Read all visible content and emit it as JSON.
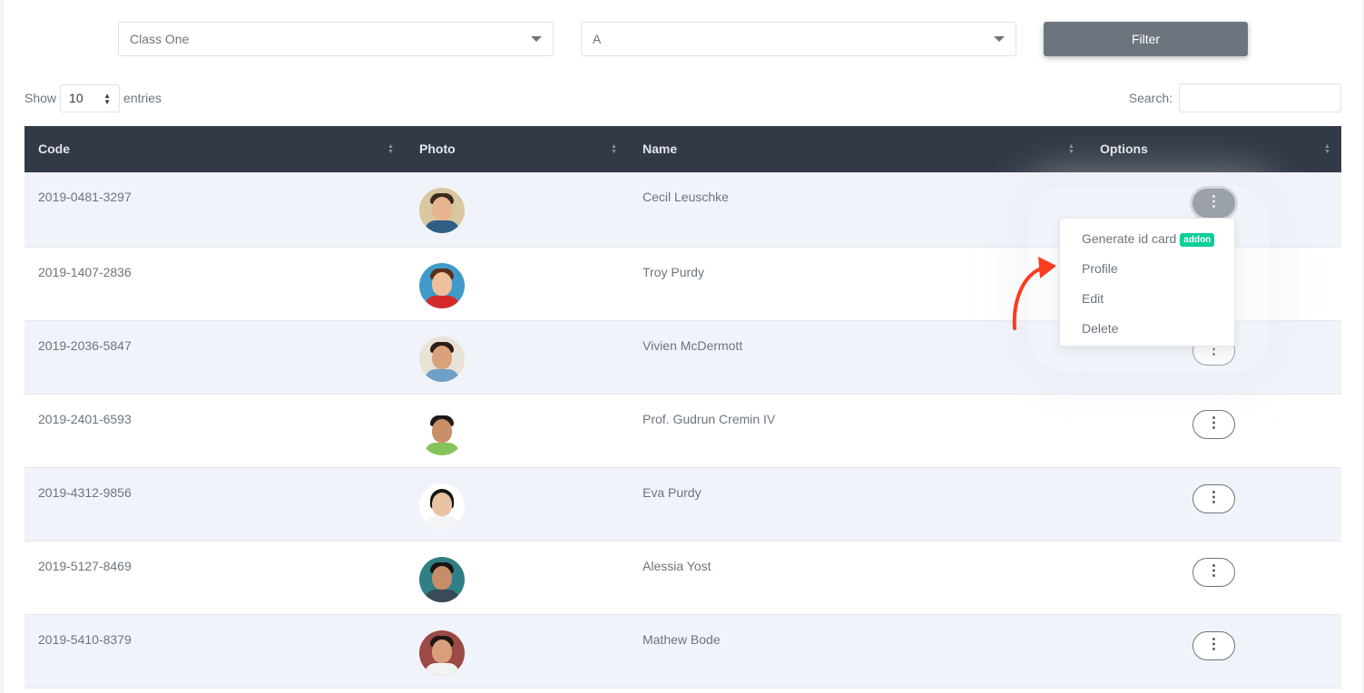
{
  "filters": {
    "class_value": "Class One",
    "section_value": "A",
    "filter_label": "Filter"
  },
  "length": {
    "show_label": "Show",
    "value": "10",
    "entries_label": "entries"
  },
  "search": {
    "label": "Search:",
    "placeholder": ""
  },
  "table": {
    "headers": [
      "Code",
      "Photo",
      "Name",
      "Options"
    ],
    "rows": [
      {
        "code": "2019-0481-3297",
        "name": "Cecil Leuschke"
      },
      {
        "code": "2019-1407-2836",
        "name": "Troy Purdy"
      },
      {
        "code": "2019-2036-5847",
        "name": "Vivien McDermott"
      },
      {
        "code": "2019-2401-6593",
        "name": "Prof. Gudrun Cremin IV"
      },
      {
        "code": "2019-4312-9856",
        "name": "Eva Purdy"
      },
      {
        "code": "2019-5127-8469",
        "name": "Alessia Yost"
      },
      {
        "code": "2019-5410-8379",
        "name": "Mathew Bode"
      }
    ],
    "options_icon": "⋮"
  },
  "menu": {
    "items": [
      "Generate id card",
      "Profile",
      "Edit",
      "Delete"
    ],
    "badge": "addon"
  },
  "colors": {
    "header_bg": "#313a46",
    "row_stripe": "#f1f3fa",
    "button_gray": "#6c757d",
    "badge_green": "#0acf97",
    "arrow_red": "#ff3b1f"
  },
  "icons": {
    "sort": "sort-arrows-icon",
    "options": "vertical-ellipsis-icon",
    "caret": "caret-down-icon",
    "annotation": "curved-arrow-icon"
  }
}
